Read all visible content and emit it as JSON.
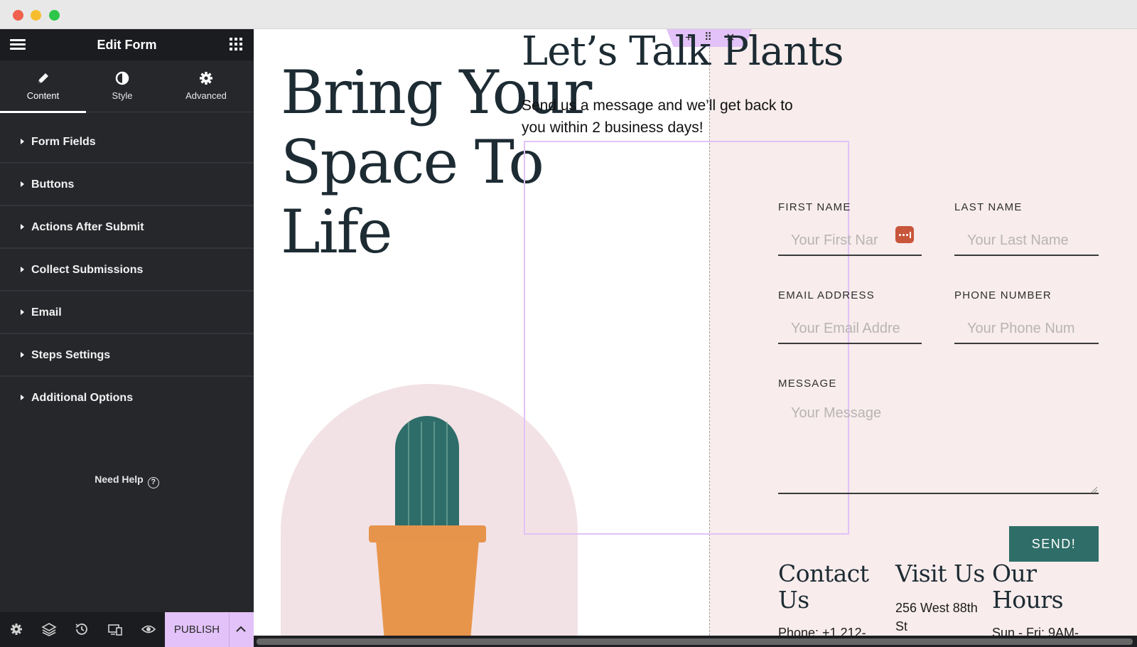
{
  "window": {
    "controls": [
      "close",
      "minimize",
      "maximize"
    ]
  },
  "sidebar": {
    "title": "Edit Form",
    "tabs": [
      {
        "label": "Content",
        "icon": "pencil-icon",
        "active": true
      },
      {
        "label": "Style",
        "icon": "contrast-icon",
        "active": false
      },
      {
        "label": "Advanced",
        "icon": "gear-icon",
        "active": false
      }
    ],
    "sections": [
      {
        "label": "Form Fields"
      },
      {
        "label": "Buttons"
      },
      {
        "label": "Actions After Submit"
      },
      {
        "label": "Collect Submissions"
      },
      {
        "label": "Email"
      },
      {
        "label": "Steps Settings"
      },
      {
        "label": "Additional Options"
      }
    ],
    "need_help": "Need Help",
    "help_icon_glyph": "?",
    "footer": {
      "icons": [
        "settings-icon",
        "layers-icon",
        "history-icon",
        "responsive-icon",
        "preview-icon"
      ],
      "publish_label": "PUBLISH"
    },
    "accent": "#e2c2f8",
    "background": "#26272b"
  },
  "canvas": {
    "hero": [
      "Bring Your",
      "Space To",
      "Life"
    ],
    "section_controls": {
      "add_glyph": "+",
      "move_glyph": "⠿",
      "close_glyph": "×"
    },
    "form": {
      "title": "Let’s Talk Plants",
      "subtitle": "Send us a message and we’ll get back to you within 2 business days!",
      "fields": {
        "first_name": {
          "label": "FIRST NAME",
          "placeholder": "Your First Nar"
        },
        "last_name": {
          "label": "LAST NAME",
          "placeholder": "Your Last Name"
        },
        "email": {
          "label": "EMAIL ADDRESS",
          "placeholder": "Your Email Addre"
        },
        "phone": {
          "label": "PHONE NUMBER",
          "placeholder": "Your Phone Num"
        },
        "message": {
          "label": "MESSAGE",
          "placeholder": "Your Message"
        }
      },
      "submit_label": "SEND!",
      "button_color": "#2f6e68"
    },
    "info": {
      "contact": {
        "title": "Contact Us",
        "text": "Phone: +1 212-"
      },
      "visit": {
        "title": "Visit Us",
        "text": "256 West 88th St"
      },
      "hours": {
        "title": "Our Hours",
        "text": "Sun - Fri: 9AM-"
      }
    },
    "right_bg": "#f8ecec"
  }
}
